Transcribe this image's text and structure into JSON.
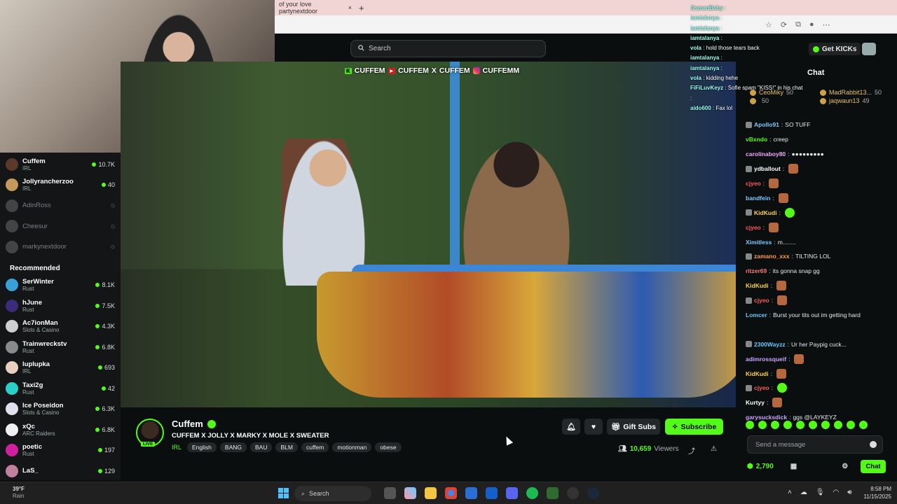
{
  "browser": {
    "tab_title": "of your love partynextdoor",
    "new_tab": "+",
    "close_tab": "×"
  },
  "overlay_chat": [
    {
      "user": "OsmanBaby",
      "text": ""
    },
    {
      "user": "iamtalanya",
      "text": ""
    },
    {
      "user": "iamtalanya",
      "text": ""
    },
    {
      "user": "iamtalanya",
      "text": ""
    },
    {
      "user": "vola",
      "text": "hold those tears back"
    },
    {
      "user": "iamtalanya",
      "text": ""
    },
    {
      "user": "iamtalanya",
      "text": ""
    },
    {
      "user": "vola",
      "text": "kidding hehe"
    },
    {
      "user": "FiFiLuvKeyz",
      "text": "Sofie spam \"KISS!\" in his chat"
    },
    {
      "user": "",
      "text": ""
    },
    {
      "user": "aido600",
      "text": "Fax lol"
    }
  ],
  "search": {
    "placeholder": "Search"
  },
  "video_overlay": {
    "k": "K",
    "handle1": "CUFFEM",
    "yt": "▶",
    "handle2": "CUFFEM",
    "x": "X",
    "handle3": "CUFFEM",
    "handle4": "CUFFEMM"
  },
  "sidebar": {
    "following": [
      {
        "name": "Cuffem",
        "category": "IRL",
        "viewers": "10.7K",
        "color": "#5b3a2c",
        "online": true
      },
      {
        "name": "Jollyrancherzoo",
        "category": "IRL",
        "viewers": "40",
        "color": "#c49a5a",
        "online": true
      },
      {
        "name": "AdinRoss",
        "category": "",
        "viewers": "",
        "color": "#555",
        "online": false
      },
      {
        "name": "Cheesur",
        "category": "",
        "viewers": "",
        "color": "#555",
        "online": false
      },
      {
        "name": "markynextdoor",
        "category": "",
        "viewers": "",
        "color": "#555",
        "online": false
      }
    ],
    "recommended_heading": "Recommended",
    "recommended": [
      {
        "name": "SerWinter",
        "category": "Rust",
        "viewers": "8.1K",
        "color": "#3aa0d8"
      },
      {
        "name": "hJune",
        "category": "Rust",
        "viewers": "7.5K",
        "color": "#3c2a7a"
      },
      {
        "name": "Ac7ionMan",
        "category": "Slots & Casino",
        "viewers": "4.3K",
        "color": "#cfcfcf"
      },
      {
        "name": "Trainwreckstv",
        "category": "Rust",
        "viewers": "6.8K",
        "color": "#8a8a8a"
      },
      {
        "name": "luplupka",
        "category": "IRL",
        "viewers": "693",
        "color": "#e8d0c0"
      },
      {
        "name": "Taxi2g",
        "category": "Rust",
        "viewers": "42",
        "color": "#2ad0c8"
      },
      {
        "name": "Ice Poseidon",
        "category": "Slots & Casino",
        "viewers": "6.3K",
        "color": "#e0e0f0"
      },
      {
        "name": "xQc",
        "category": "ARC Raiders",
        "viewers": "6.8K",
        "color": "#f0f0f0"
      },
      {
        "name": "poetic",
        "category": "Rust",
        "viewers": "197",
        "color": "#d020a0"
      },
      {
        "name": "LaS_",
        "category": "",
        "viewers": "129",
        "color": "#c080a0"
      }
    ]
  },
  "chat_panel": {
    "get_kicks": "Get KICKs",
    "title": "Chat",
    "leaders": [
      {
        "name": "CeoMiky",
        "score": "50"
      },
      {
        "name": "MadRabbit13...",
        "score": "50"
      },
      {
        "name": "",
        "score": "50"
      },
      {
        "name": "jaqwaun13",
        "score": "49"
      }
    ],
    "messages": [
      {
        "user": "Apollo91",
        "color": "#7ec8ff",
        "text": "SO TUFF"
      },
      {
        "user": "vBxndo",
        "color": "#53fc18",
        "text": "creep"
      },
      {
        "user": "carolinaboy80",
        "color": "#f2a4ff",
        "text": "●●●●●●●●●"
      },
      {
        "user": "ydballout",
        "color": "#fff",
        "text": ""
      },
      {
        "user": "cjyeo",
        "color": "#ff5a5a",
        "text": ""
      },
      {
        "user": "bandfein",
        "color": "#7ec8ff",
        "text": ""
      },
      {
        "user": "KidKudi",
        "color": "#ffd24a",
        "text": ""
      },
      {
        "user": "cjyeo",
        "color": "#ff5a5a",
        "text": ""
      },
      {
        "user": "Ximitless",
        "color": "#7ec8ff",
        "text": "m........"
      },
      {
        "user": "zamano_xxx",
        "color": "#ff9a4a",
        "text": "TILTING LOL"
      },
      {
        "user": "ritzer69",
        "color": "#ff7a7a",
        "text": "its gonna snap gg"
      },
      {
        "user": "KidKudi",
        "color": "#ffd24a",
        "text": ""
      },
      {
        "user": "cjyeo",
        "color": "#ff5a5a",
        "text": ""
      },
      {
        "user": "Lomcer",
        "color": "#6ac6ff",
        "text": "Burst your tits out im getting hard"
      },
      {
        "user": "",
        "color": "#fff",
        "text": ""
      },
      {
        "user": "2300Wayzz",
        "color": "#6ac6ff",
        "text": "Ur her Paypig cuck..."
      },
      {
        "user": "adimrossqueif",
        "color": "#c7a4ff",
        "text": ""
      },
      {
        "user": "KidKudi",
        "color": "#ffd24a",
        "text": ""
      },
      {
        "user": "cjyeo",
        "color": "#ff5a5a",
        "text": ""
      },
      {
        "user": "Kurtyy",
        "color": "#fff",
        "text": ""
      },
      {
        "user": "garysucksdick",
        "color": "#c7a4ff",
        "text": "ggs @LAYKEYZ"
      }
    ],
    "input_placeholder": "Send a message",
    "kicks_balance": "2,790",
    "chat_button": "Chat"
  },
  "stream": {
    "channel": "Cuffem",
    "live": "LIVE",
    "title": "CUFFEM X JOLLY X MARKY X MOLE X SWEATER",
    "category": "IRL",
    "tags": [
      "English",
      "BANG",
      "BAU",
      "BLM",
      "cuffem",
      "motionman",
      "obese"
    ],
    "gift_subs": "Gift Subs",
    "subscribe": "Subscribe",
    "viewer_count": "10,659",
    "viewers_label": "Viewers"
  },
  "taskbar": {
    "temp": "39°F",
    "condition": "Rain",
    "search": "Search",
    "time": "8:58 PM",
    "date": "11/15/2025"
  }
}
